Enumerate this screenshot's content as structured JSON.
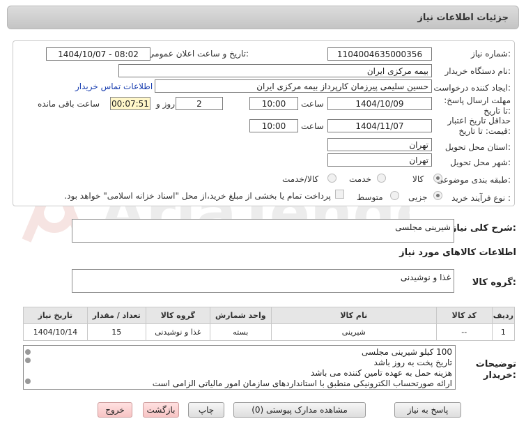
{
  "page": {
    "title": "جزئیات اطلاعات نیاز"
  },
  "form": {
    "need_number_label": "شماره نیاز:",
    "need_number": "1104004635000356",
    "announce_label": "تاریخ و ساعت اعلان عمومی:",
    "announce_value": "1404/10/07 - 08:02",
    "buyer_org_label": "نام دستگاه خریدار:",
    "buyer_org": "بیمه مرکزی ایران",
    "creator_label": "ایجاد کننده درخواست:",
    "creator": "حسین سلیمی پیرزمان کارپرداز بیمه مرکزی ایران",
    "contact_link": "اطلاعات تماس خریدار",
    "deadline_label": "مهلت ارسال پاسخ: تا تاریخ:",
    "deadline_date": "1404/10/09",
    "time_label": "ساعت",
    "deadline_time": "10:00",
    "days_value": "2",
    "days_and_label": "روز و",
    "remaining_timer": "00:07:51",
    "remaining_label": "ساعت باقی مانده",
    "validity_label": "حداقل تاریخ اعتبار قیمت: تا تاریخ:",
    "validity_date": "1404/11/07",
    "validity_time": "10:00",
    "province_label": "استان محل تحویل:",
    "province": "تهران",
    "city_label": "شهر محل تحویل:",
    "city": "تهران",
    "category_label": "طبقه بندی موضوعی:",
    "category_options": [
      "کالا",
      "خدمت",
      "کالا/خدمت"
    ],
    "purchase_type_label": "نوع فرآیند خرید :",
    "purchase_options": [
      "جزیی",
      "متوسط"
    ],
    "payment_note": "پرداخت تمام یا بخشی از مبلغ خرید،از محل \"اسناد خزانه اسلامی\" خواهد بود."
  },
  "summary": {
    "label": "شرح کلی نیاز:",
    "value": "شیرینی مجلسی"
  },
  "goods_info": {
    "title": "اطلاعات کالاهای مورد نیاز",
    "group_label": "گروه کالا:",
    "group_value": "غذا و نوشیدنی"
  },
  "table": {
    "headers": [
      "ردیف",
      "کد کالا",
      "نام کالا",
      "واحد شمارش",
      "گروه کالا",
      "تعداد / مقدار",
      "تاریخ نیاز"
    ],
    "rows": [
      [
        "1",
        "--",
        "شیرینی",
        "بسته",
        "غذا و نوشیدنی",
        "15",
        "1404/10/14"
      ]
    ]
  },
  "buyer_notes": {
    "label": "توضیحات خریدار:",
    "lines": [
      "100 کیلو شیرینی مجلسی",
      "تاریخ پخت به روز  باشد",
      " هزینه حمل به عهده تامین کننده می باشد",
      "ارائه صورتحساب الکترونیکی منطبق با استانداردهای سازمان امور مالیاتی الزامی است"
    ]
  },
  "buttons": {
    "reply": "پاسخ به نیاز",
    "attachments": "مشاهده مدارک پیوستی (0)",
    "print": "چاپ",
    "back": "بازگشت",
    "exit": "خروج"
  },
  "colors": {
    "timer_bg": "#fff7c9",
    "link": "#1a3fb0",
    "pink_button": "#f7c4c4"
  },
  "watermark_text": "AriaTender.net"
}
